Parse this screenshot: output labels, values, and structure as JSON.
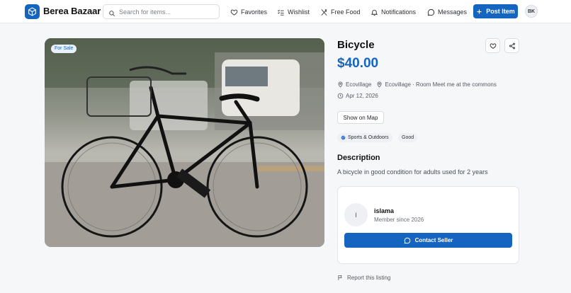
{
  "app": {
    "name": "Berea Bazaar",
    "accent": "#1565c0"
  },
  "search": {
    "placeholder": "Search for items..."
  },
  "nav": [
    {
      "label": "Favorites",
      "icon": "heart-icon"
    },
    {
      "label": "Wishlist",
      "icon": "list-icon"
    },
    {
      "label": "Free Food",
      "icon": "utensils-icon"
    },
    {
      "label": "Notifications",
      "icon": "bell-icon"
    },
    {
      "label": "Messages",
      "icon": "message-icon"
    }
  ],
  "post_button": {
    "label": "Post Item",
    "icon": "plus-icon"
  },
  "user": {
    "initials": "BK"
  },
  "listing": {
    "badge": "For Sale",
    "title": "Bicycle",
    "price": "$40.00",
    "location_primary": "Ecovillage",
    "location_secondary": "Ecovillage · Room Meet me at the commons",
    "date": "Apr 12, 2026",
    "map_button": "Show on Map",
    "category": "Sports & Outdoors",
    "condition": "Good",
    "description_heading": "Description",
    "description": "A bicycle in good condition for adults used for 2 years"
  },
  "seller": {
    "initial": "I",
    "name": "islama",
    "since": "Member since 2026",
    "contact_label": "Contact Seller"
  },
  "report_label": "Report this listing"
}
